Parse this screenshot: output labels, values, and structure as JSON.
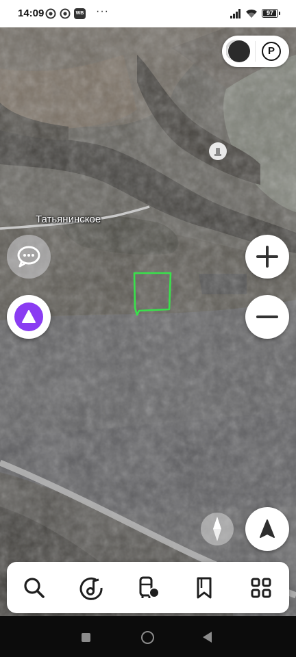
{
  "status_bar": {
    "time": "14:09",
    "notification_icons": [
      "messenger-icon",
      "messenger-icon",
      "wb-app-icon"
    ],
    "wb_badge": "WB",
    "more": "···",
    "signal_icon": "cellular-signal-icon",
    "wifi_icon": "wifi-icon",
    "battery_level": "97"
  },
  "map": {
    "view": "satellite",
    "place_label": "Татьянинское",
    "drawn_area_color": "#39e14b"
  },
  "controls": {
    "layers_toggle_icon": "map-layers-icon",
    "parking_label": "P",
    "zoom_in_icon": "plus-icon",
    "zoom_out_icon": "minus-icon",
    "chat_icon": "chat-bubble-icon",
    "assistant_icon": "alice-assistant-icon",
    "compass_icon": "compass-icon",
    "location_icon": "navigation-arrow-icon"
  },
  "toolbar": {
    "items": [
      {
        "icon": "search-icon"
      },
      {
        "icon": "music-note-icon"
      },
      {
        "icon": "transport-icon"
      },
      {
        "icon": "bookmark-icon"
      },
      {
        "icon": "services-grid-icon"
      }
    ]
  },
  "nav_bar": {
    "icons": [
      "recent-apps-icon",
      "home-icon",
      "back-icon"
    ]
  },
  "colors": {
    "accent_purple": "#8a3cf2",
    "toolbar_bg": "#ffffff",
    "map_field": "#5d5d5f"
  }
}
